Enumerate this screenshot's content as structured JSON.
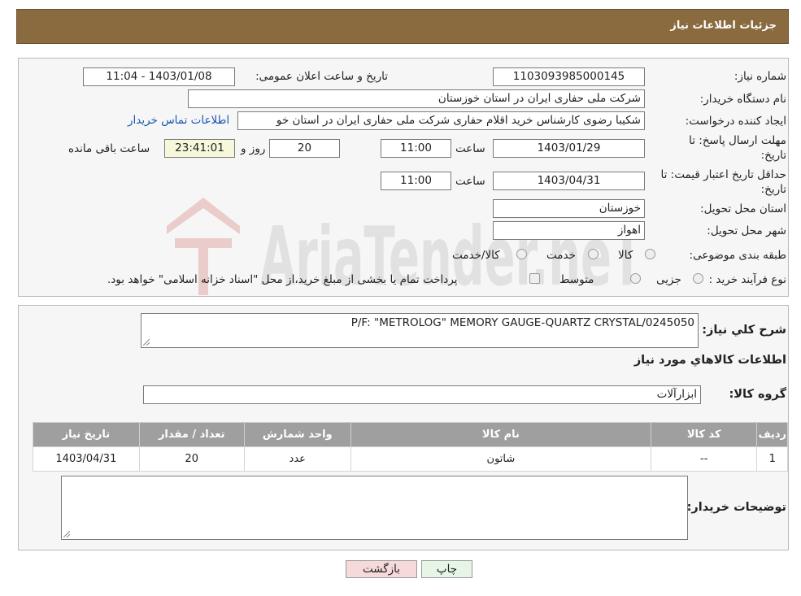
{
  "header": {
    "title": "جزئیات اطلاعات نیاز"
  },
  "fields": {
    "need_number_label": "شماره نیاز:",
    "need_number": "1103093985000145",
    "announce_label": "تاریخ و ساعت اعلان عمومی:",
    "announce_value": "1403/01/08 - 11:04",
    "buyer_org_label": "نام دستگاه خریدار:",
    "buyer_org": "شرکت ملی حفاری ایران در استان خوزستان",
    "creator_label": "ایجاد کننده درخواست:",
    "creator": "شکیبا رضوی کارشناس خرید اقلام حفاری شرکت ملی حفاری ایران در استان خو",
    "contact_link": "اطلاعات تماس خریدار",
    "deadline_label_1": "مهلت ارسال پاسخ: تا",
    "deadline_label_2": "تاریخ:",
    "deadline_date": "1403/01/29",
    "time_label": "ساعت",
    "deadline_time": "11:00",
    "days_value": "20",
    "days_label": "روز و",
    "remaining_time": "23:41:01",
    "remaining_label": "ساعت باقی مانده",
    "validity_label_1": "حداقل تاریخ اعتبار قیمت: تا",
    "validity_label_2": "تاریخ:",
    "validity_date": "1403/04/31",
    "validity_time_label": "ساعت",
    "validity_time": "11:00",
    "province_label": "استان محل تحویل:",
    "province": "خوزستان",
    "city_label": "شهر محل تحویل:",
    "city": "اهواز",
    "category_label": "طبقه بندی موضوعی:",
    "category_options": [
      "کالا",
      "خدمت",
      "کالا/خدمت"
    ],
    "process_label": "نوع فرآیند خرید :",
    "process_options": [
      "جزیی",
      "متوسط"
    ],
    "process_note": "پرداخت تمام یا بخشی از مبلغ خرید،از محل \"اسناد خزانه اسلامی\" خواهد بود."
  },
  "watermark": {
    "text": "AriaTender.neT"
  },
  "details": {
    "summary_label": "شرح کلي نياز:",
    "summary": "P/F: \"METROLOG\" MEMORY GAUGE-QUARTZ CRYSTAL/0245050",
    "items_title": "اطلاعات کالاهاي مورد نياز",
    "group_label": "گروه کالا:",
    "group_value": "ابزارآلات",
    "table": {
      "headers": [
        "ردیف",
        "کد کالا",
        "نام کالا",
        "واحد شمارش",
        "تعداد / مقدار",
        "تاریخ نیاز"
      ],
      "rows": [
        [
          "1",
          "--",
          "شاتون",
          "عدد",
          "20",
          "1403/04/31"
        ]
      ]
    },
    "buyer_notes_label": "توضیحات خریدار:"
  },
  "buttons": {
    "print": "چاپ",
    "back": "بازگشت"
  },
  "colors": {
    "header_bg": "#8a6a3f",
    "table_header_bg": "#9f9f9f",
    "link": "#1a56b0",
    "back_btn_bg": "#f6dada",
    "print_btn_bg": "#e6f5e6"
  }
}
